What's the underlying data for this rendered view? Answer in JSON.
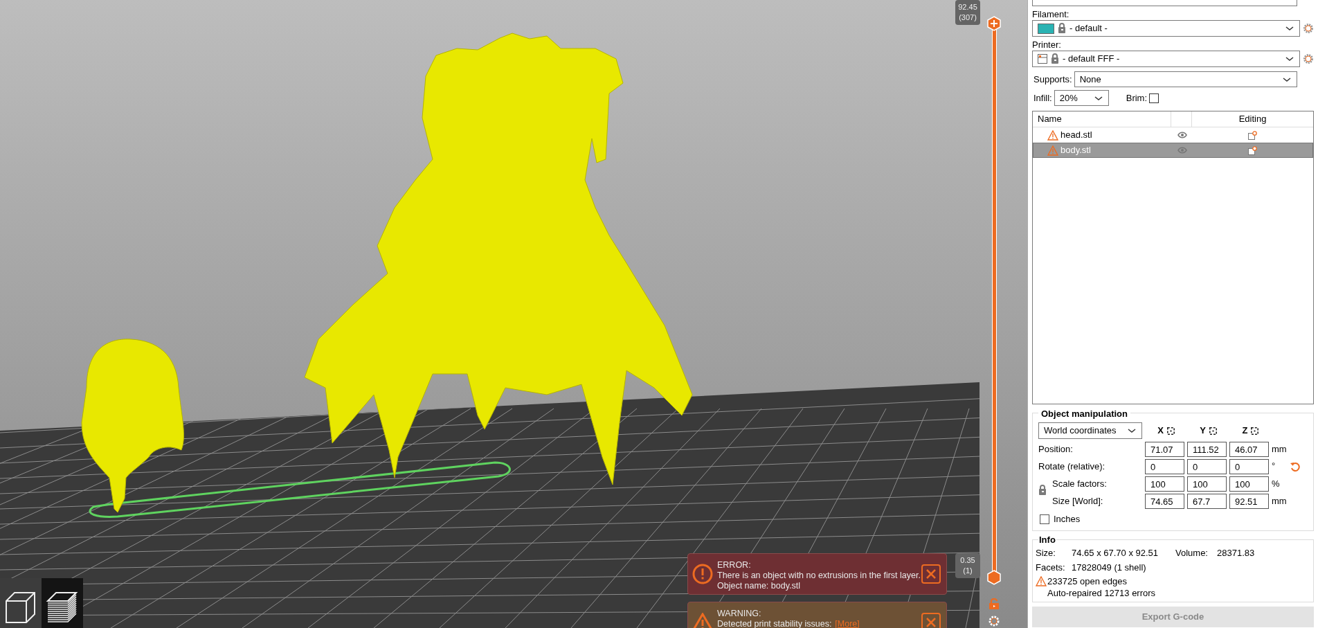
{
  "filament": {
    "label": "Filament:",
    "value": "- default -"
  },
  "printer": {
    "label": "Printer:",
    "value": "- default FFF -"
  },
  "supports": {
    "label": "Supports:",
    "value": "None"
  },
  "infill": {
    "label": "Infill:",
    "value": "20%"
  },
  "brim": {
    "label": "Brim:",
    "checked": false
  },
  "objects": {
    "columns": [
      "Name",
      "Editing"
    ],
    "rows": [
      {
        "name": "head.stl",
        "selected": false
      },
      {
        "name": "body.stl",
        "selected": true
      }
    ]
  },
  "object_manipulation": {
    "title": "Object manipulation",
    "coordinates": "World coordinates",
    "axes": [
      "X",
      "Y",
      "Z"
    ],
    "rows": [
      {
        "label": "Position:",
        "values": [
          "71.07",
          "111.52",
          "46.07"
        ],
        "unit": "mm"
      },
      {
        "label": "Rotate (relative):",
        "values": [
          "0",
          "0",
          "0"
        ],
        "unit": "°"
      },
      {
        "label": "Scale factors:",
        "values": [
          "100",
          "100",
          "100"
        ],
        "unit": "%"
      },
      {
        "label": "Size [World]:",
        "values": [
          "74.65",
          "67.7",
          "92.51"
        ],
        "unit": "mm"
      }
    ],
    "inches": {
      "label": "Inches",
      "checked": false
    }
  },
  "info": {
    "title": "Info",
    "size_label": "Size:",
    "size": "74.65 x 67.70 x 92.51",
    "volume_label": "Volume:",
    "volume": "28371.83",
    "facets_label": "Facets:",
    "facets": "17828049 (1 shell)",
    "warnings": [
      "233725 open edges",
      "Auto-repaired 12713 errors"
    ]
  },
  "export_button": {
    "label": "Export G-code",
    "disabled": true
  },
  "layer_slider": {
    "top": {
      "value": "92.45",
      "layer": "(307)"
    },
    "bottom": {
      "value": "0.35",
      "layer": "(1)"
    }
  },
  "notifications": [
    {
      "kind": "error",
      "title": "ERROR:",
      "lines": [
        "There is an object with no extrusions in the first layer.",
        "Object name: body.stl"
      ]
    },
    {
      "kind": "warning",
      "title": "WARNING:",
      "lines": [
        "Detected print stability issues:"
      ],
      "link": "[More]"
    }
  ],
  "view_toggles": [
    {
      "selected": false
    },
    {
      "selected": true
    }
  ]
}
